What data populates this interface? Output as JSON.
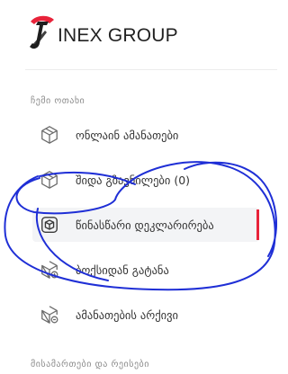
{
  "brand": {
    "name": "INEX GROUP",
    "accent_color": "#e8233a"
  },
  "sidebar": {
    "sections": [
      {
        "label": "ჩემი ოთახი",
        "items": [
          {
            "label": "ონლაინ ამანათები",
            "icon": "package-icon",
            "active": false
          },
          {
            "label": "შიდა გზავნილები (0)",
            "icon": "package-icon",
            "active": false
          },
          {
            "label": "წინასწარი დეკლარირება",
            "icon": "package-declare-icon",
            "active": true
          },
          {
            "label": "ბოქსიდან გატანა",
            "icon": "package-clock-icon",
            "active": false
          },
          {
            "label": "ამანათების არქივი",
            "icon": "package-archive-icon",
            "active": false
          }
        ]
      },
      {
        "label": "მისამართები და რეისები",
        "items": []
      }
    ]
  },
  "annotation_color": "#1f2fd6"
}
